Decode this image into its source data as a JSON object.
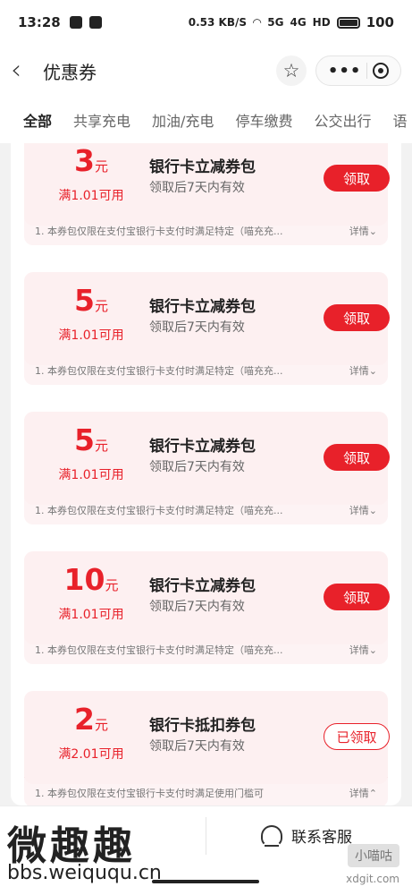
{
  "status_bar": {
    "time": "13:28",
    "net_speed": "0.53 KB/S",
    "signal_1": "5G",
    "signal_2": "4G",
    "hd": "HD",
    "battery": "100"
  },
  "nav": {
    "title": "优惠券",
    "back_icon": "chevron-left-icon",
    "star_icon": "star-icon",
    "more_icon": "more-dots-icon",
    "target_icon": "target-icon"
  },
  "tabs": [
    "全部",
    "共享充电",
    "加油/充电",
    "停车缴费",
    "公交出行",
    "语"
  ],
  "coupons": [
    {
      "amount": "3",
      "unit": "元",
      "condition": "满1.01可用",
      "title": "银行卡立减券包",
      "subtitle": "领取后7天内有效",
      "button": "领取",
      "claimed": false,
      "note": "1. 本券包仅限在支付宝银行卡支付时满足特定（喵充充...",
      "detail": "详情"
    },
    {
      "amount": "5",
      "unit": "元",
      "condition": "满1.01可用",
      "title": "银行卡立减券包",
      "subtitle": "领取后7天内有效",
      "button": "领取",
      "claimed": false,
      "note": "1. 本券包仅限在支付宝银行卡支付时满足特定（喵充充...",
      "detail": "详情"
    },
    {
      "amount": "5",
      "unit": "元",
      "condition": "满1.01可用",
      "title": "银行卡立减券包",
      "subtitle": "领取后7天内有效",
      "button": "领取",
      "claimed": false,
      "note": "1. 本券包仅限在支付宝银行卡支付时满足特定（喵充充...",
      "detail": "详情"
    },
    {
      "amount": "10",
      "unit": "元",
      "condition": "满1.01可用",
      "title": "银行卡立减券包",
      "subtitle": "领取后7天内有效",
      "button": "领取",
      "claimed": false,
      "note": "1. 本券包仅限在支付宝银行卡支付时满足特定（喵充充...",
      "detail": "详情"
    },
    {
      "amount": "2",
      "unit": "元",
      "condition": "满2.01可用",
      "title": "银行卡抵扣券包",
      "subtitle": "领取后7天内有效",
      "button": "已领取",
      "claimed": true,
      "note": "1. 本券包仅限在支付宝银行卡支付时满足使用门槛可",
      "detail": "详情"
    }
  ],
  "bottom": {
    "customer_service": "联系客服",
    "watermark_main": "微趣趣",
    "watermark_url": "bbs.weiququ.cn",
    "watermark_badge": "小喵咕",
    "watermark_site": "xdgit.com"
  },
  "colors": {
    "accent": "#e8212a",
    "coupon_bg": "#fdf0f1"
  }
}
